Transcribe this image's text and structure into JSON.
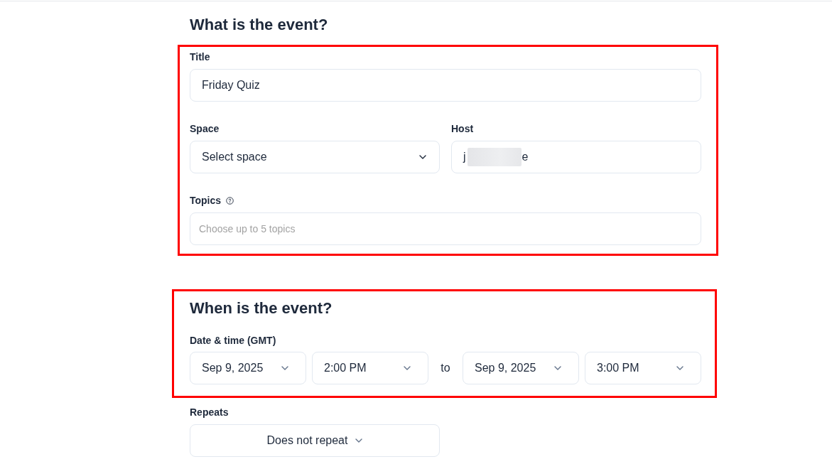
{
  "event_section": {
    "heading": "What is the event?",
    "highlighted": true,
    "title": {
      "label": "Title",
      "value": "Friday Quiz"
    },
    "space": {
      "label": "Space",
      "value": "Select space"
    },
    "host": {
      "label": "Host",
      "value_start": "j",
      "redacted": true,
      "value_end": "e"
    },
    "topics": {
      "label": "Topics",
      "placeholder": "Choose up to 5 topics"
    }
  },
  "time_section": {
    "heading": "When is the event?",
    "highlighted": true,
    "date_time": {
      "label": "Date & time (GMT)",
      "start_date": "Sep 9, 2025",
      "start_time": "2:00 PM",
      "separator": "to",
      "end_date": "Sep 9, 2025",
      "end_time": "3:00 PM"
    }
  },
  "repeats": {
    "label": "Repeats",
    "value": "Does not repeat"
  }
}
